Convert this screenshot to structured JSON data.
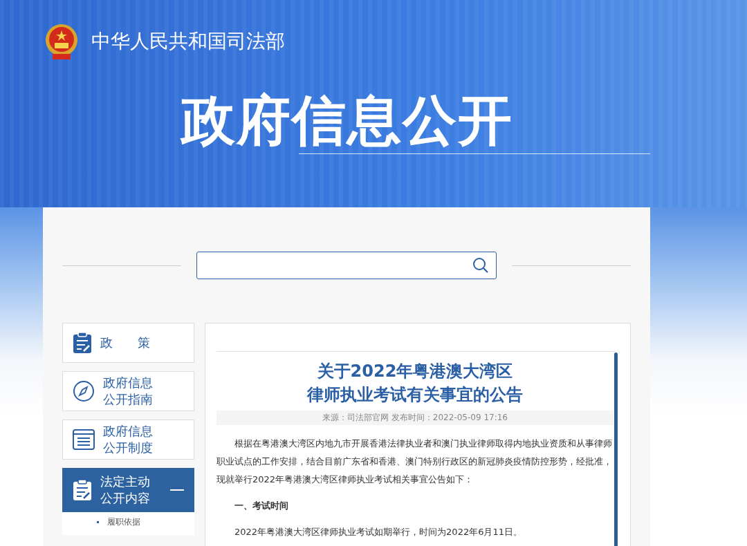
{
  "header": {
    "org_name": "中华人民共和国司法部",
    "banner_title": "政府信息公开"
  },
  "sidebar": {
    "items": [
      {
        "kind": "clipboard",
        "lines": [
          "政　　策"
        ],
        "selected": false,
        "expanded": false
      },
      {
        "kind": "compass",
        "lines": [
          "政府信息",
          "公开指南"
        ],
        "selected": false,
        "expanded": false
      },
      {
        "kind": "list",
        "lines": [
          "政府信息",
          "公开制度"
        ],
        "selected": false,
        "expanded": false
      },
      {
        "kind": "clipboard",
        "lines": [
          "法定主动",
          "公开内容"
        ],
        "selected": true,
        "expanded": true,
        "children": [
          {
            "label": "履职依据"
          }
        ]
      }
    ]
  },
  "article": {
    "title_lines": [
      "关于2022年粤港澳大湾区",
      "律师执业考试有关事宜的公告"
    ],
    "meta": "来源：司法部官网 发布时间：2022-05-09 17:16",
    "blocks": [
      {
        "kind": "paragraph",
        "text": "根据在粤港澳大湾区内地九市开展香港法律执业者和澳门执业律师取得内地执业资质和从事律师职业试点的工作安排，结合目前广东省和香港、澳门特别行政区的新冠肺炎疫情防控形势，经批准，现就举行2022年粤港澳大湾区律师执业考试相关事宜公告如下："
      },
      {
        "kind": "heading",
        "text": "一、考试时间"
      },
      {
        "kind": "paragraph",
        "text": "2022年粤港澳大湾区律师执业考试如期举行，时间为2022年6月11日。"
      }
    ]
  }
}
